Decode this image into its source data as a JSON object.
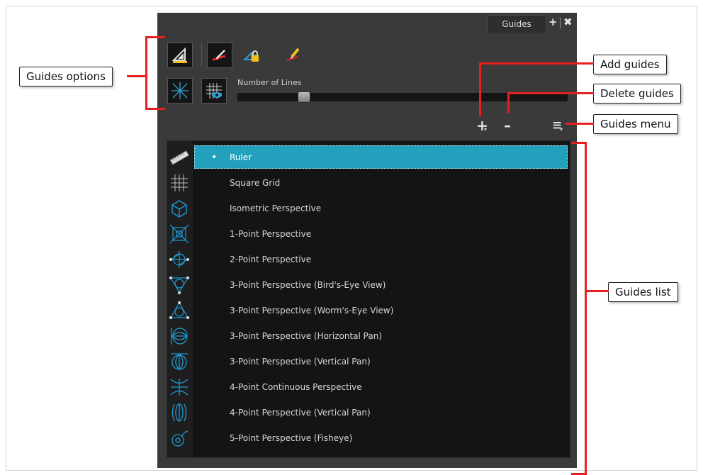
{
  "panel": {
    "tab_label": "Guides",
    "add_panel_glyph": "+",
    "close_panel_glyph": "✖",
    "slider_label": "Number of Lines",
    "slider_value_fraction": 0.1,
    "add_glyph": "+",
    "delete_glyph": "–",
    "menu_glyph": "≡"
  },
  "guides": [
    {
      "label": "Ruler",
      "icon": "ruler-icon",
      "selected": true
    },
    {
      "label": "Square Grid",
      "icon": "square-grid-icon"
    },
    {
      "label": "Isometric Perspective",
      "icon": "isometric-perspective-icon"
    },
    {
      "label": "1-Point Perspective",
      "icon": "one-point-perspective-icon"
    },
    {
      "label": "2-Point Perspective",
      "icon": "two-point-perspective-icon"
    },
    {
      "label": "3-Point Perspective (Bird's-Eye View)",
      "icon": "three-point-birds-eye-icon"
    },
    {
      "label": "3-Point Perspective (Worm's-Eye View)",
      "icon": "three-point-worms-eye-icon"
    },
    {
      "label": "3-Point Perspective (Horizontal Pan)",
      "icon": "three-point-horizontal-pan-icon"
    },
    {
      "label": "3-Point Perspective (Vertical Pan)",
      "icon": "three-point-vertical-pan-icon"
    },
    {
      "label": "4-Point Continuous Perspective",
      "icon": "four-point-continuous-icon"
    },
    {
      "label": "4-Point Perspective (Vertical Pan)",
      "icon": "four-point-vertical-pan-icon"
    },
    {
      "label": "5-Point Perspective (Fisheye)",
      "icon": "five-point-fisheye-icon"
    }
  ],
  "callouts": {
    "guides_options": "Guides options",
    "add_guides": "Add guides",
    "delete_guides": "Delete guides",
    "guides_menu": "Guides menu",
    "guides_list": "Guides list"
  },
  "colors": {
    "accent": "#22a0bc",
    "callout_line": "#e81f1f",
    "panel_bg": "#3a3a3a",
    "icon_blue": "#1e9ad6"
  }
}
